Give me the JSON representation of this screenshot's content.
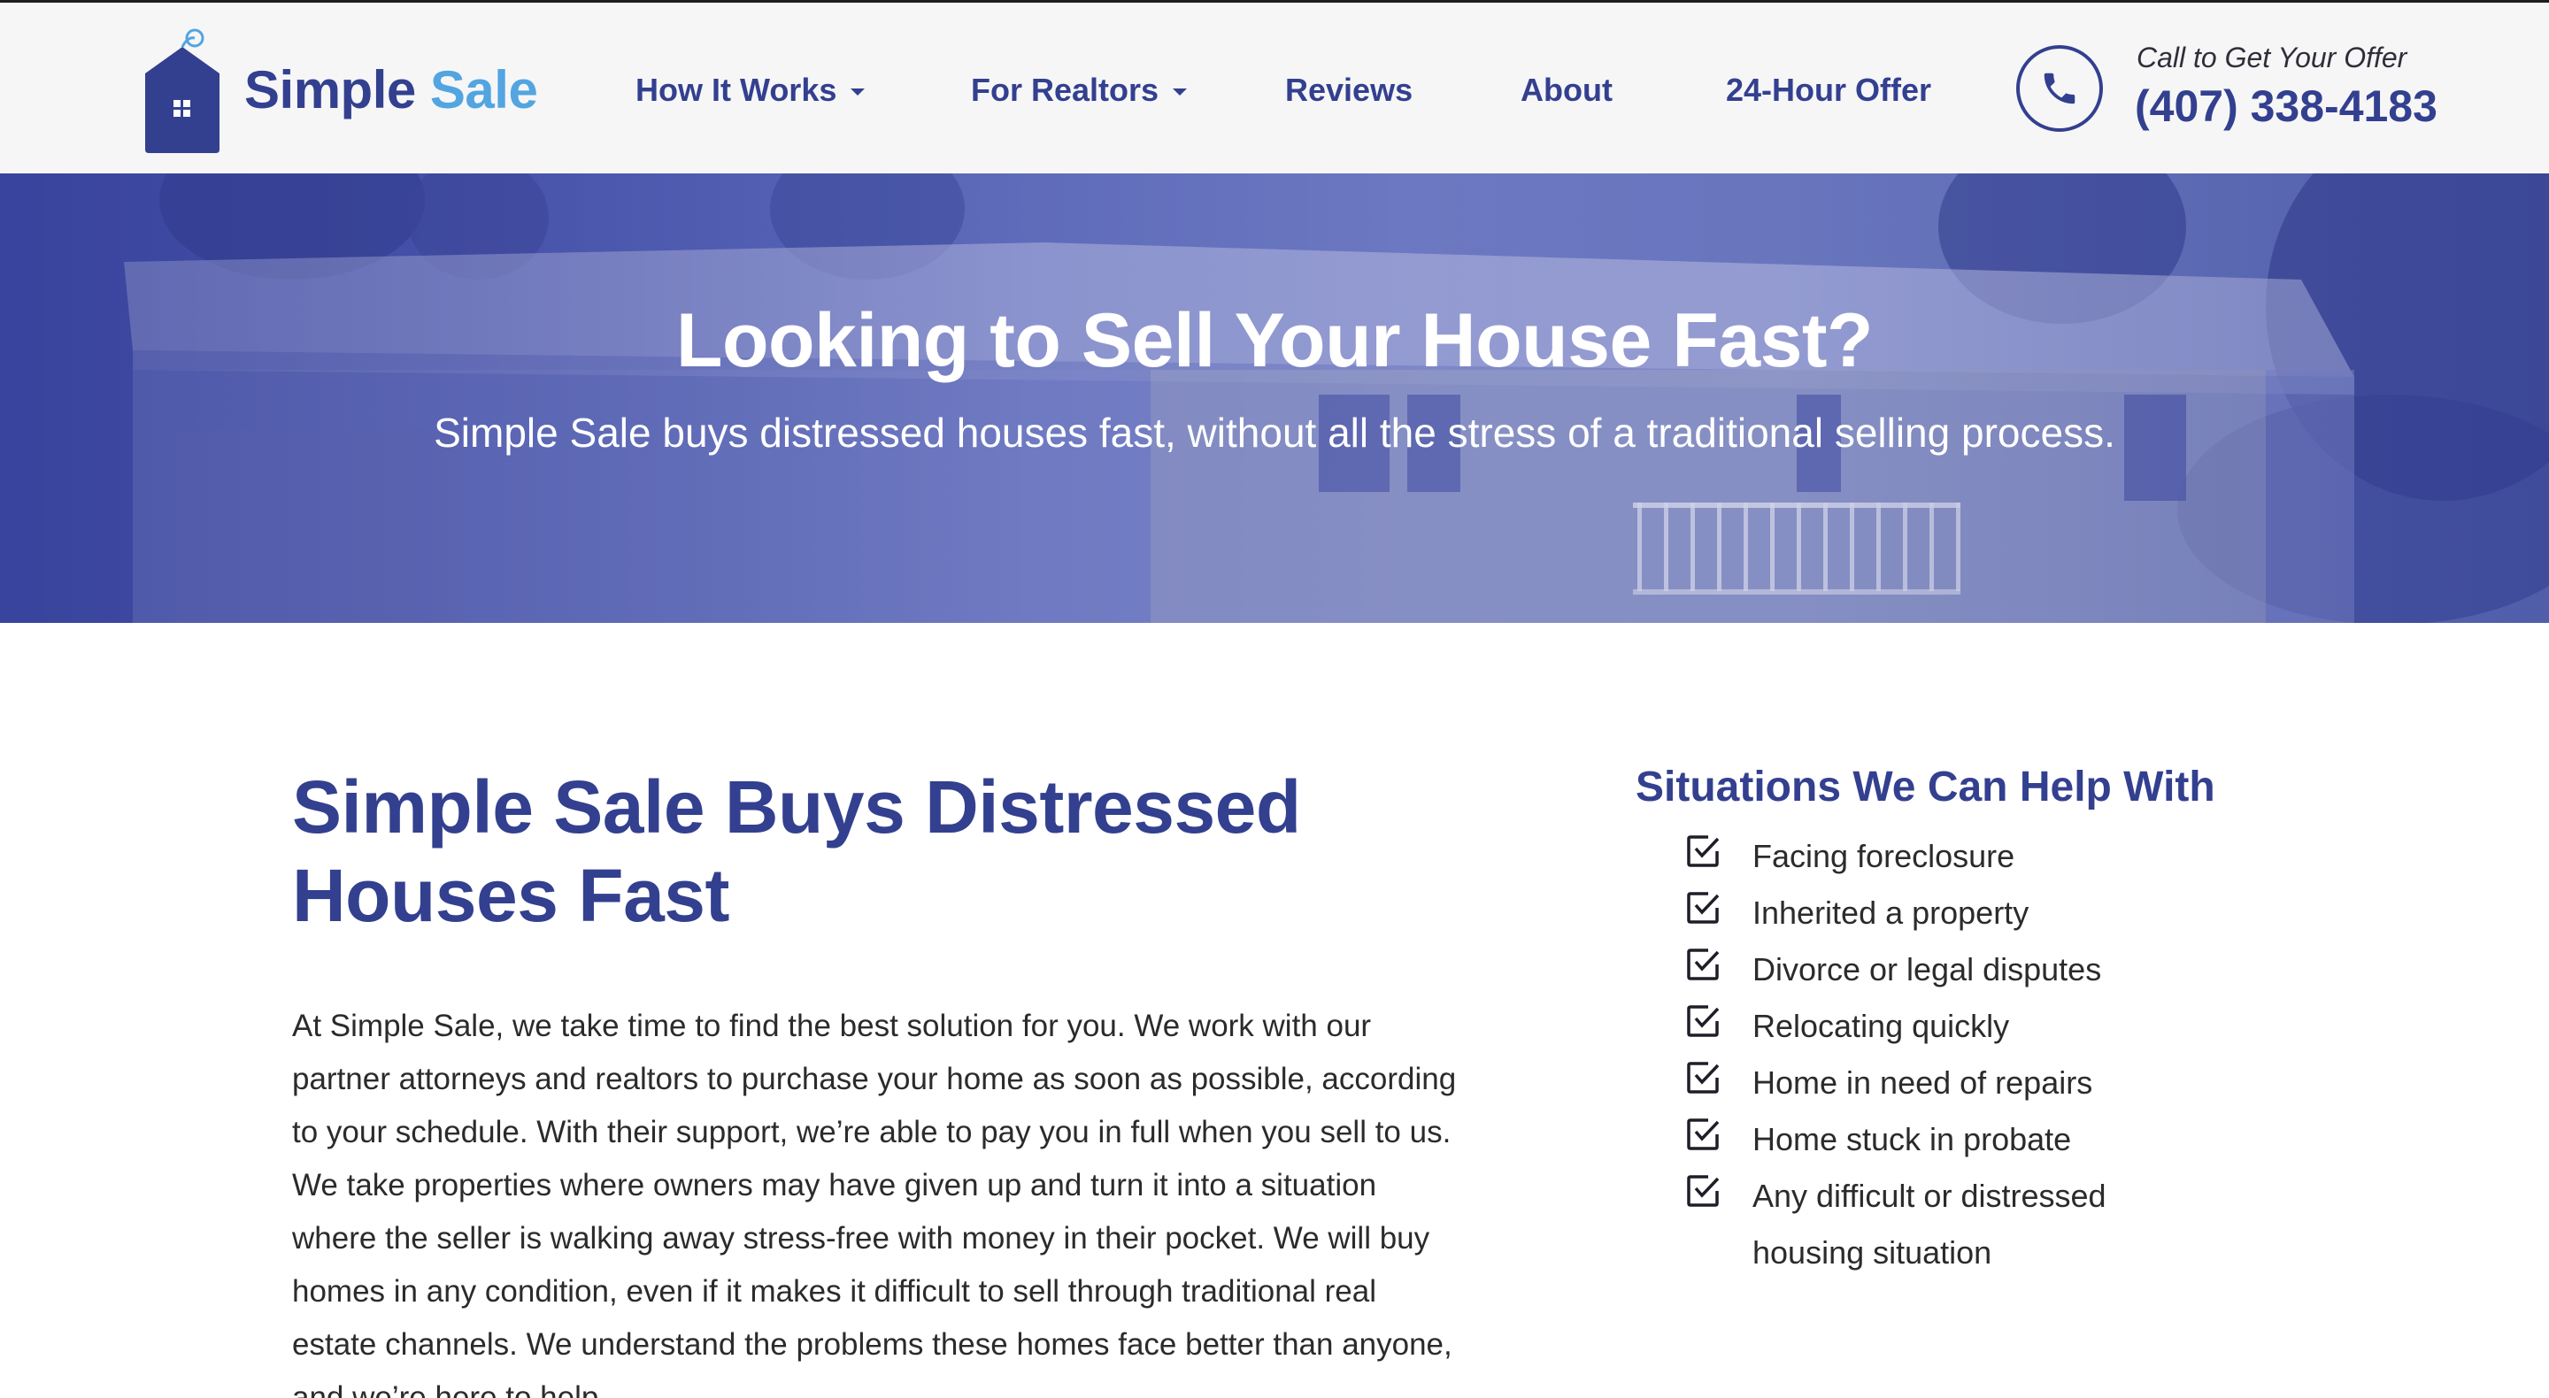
{
  "brand": {
    "name_primary": "Simple",
    "name_accent": "Sale",
    "colors": {
      "primary": "#33408f",
      "accent": "#52a5e0",
      "header_bg": "#f6f6f7"
    }
  },
  "nav": {
    "items": [
      {
        "label": "How It Works",
        "dropdown": true
      },
      {
        "label": "For Realtors",
        "dropdown": true
      },
      {
        "label": "Reviews",
        "dropdown": false
      },
      {
        "label": "About",
        "dropdown": false
      },
      {
        "label": "24-Hour Offer",
        "dropdown": false
      }
    ]
  },
  "contact": {
    "call_label": "Call to Get Your Offer",
    "phone": "(407) 338-4183",
    "icon": "phone-icon"
  },
  "hero": {
    "title": "Looking to Sell Your House Fast?",
    "subtitle": "Simple Sale buys distressed houses fast, without all the stress of a traditional selling process."
  },
  "main": {
    "title": "Simple Sale Buys Distressed Houses Fast",
    "body": "At Simple Sale, we take time to find the best solution for you. We work with our partner attorneys and realtors to purchase your home as soon as possible, according to your schedule. With their support, we’re able to pay you in full when you sell to us. We take properties where owners may have given up and turn it into a situation where the seller is walking away stress-free with money in their pocket. We will buy homes in any condition, even if it makes it difficult to sell through traditional real estate channels. We understand the problems these homes face better than anyone, and we’re here to help."
  },
  "situations": {
    "title": "Situations We Can Help With",
    "icon": "checkbox-icon",
    "items": [
      "Facing foreclosure",
      "Inherited a property",
      "Divorce or legal disputes",
      "Relocating quickly",
      "Home in need of repairs",
      "Home stuck in probate",
      "Any difficult or distressed housing situation"
    ]
  }
}
